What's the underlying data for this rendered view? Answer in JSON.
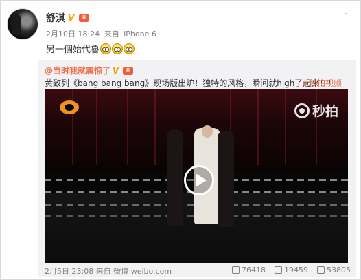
{
  "post": {
    "username": "舒淇",
    "time": "2月10日 18:24",
    "source_prefix": "来自",
    "source": "iPhone 6",
    "text": "另一個始代魯",
    "emoji_icon": "laughing-crying-emoji-icon"
  },
  "repost": {
    "username": "@当时我就震惊了",
    "text": "黄致列《bang bang bang》现场版出炉！独特的风格，瞬间就high了起来！！！",
    "video_link": "秒拍视频",
    "video": {
      "logo_right": "秒拍"
    },
    "time": "2月5日 23:08",
    "source_prefix": "来自",
    "source": "微博 weibo.com",
    "repost_count": "76418",
    "comment_count": "19459",
    "like_count": "53805"
  },
  "colors": {
    "accent": "#eb7350",
    "link": "#eb7350",
    "vip": "#f7a400",
    "muted": "#808080",
    "repost_bg": "#f2f2f5"
  },
  "icons": {
    "verified": "verified-v-icon",
    "vip": "vip-crown-icon",
    "more": "chevron-down-icon",
    "video": "video-link-icon",
    "play": "play-icon",
    "repost": "repost-icon",
    "comment": "comment-icon",
    "like": "like-icon"
  }
}
